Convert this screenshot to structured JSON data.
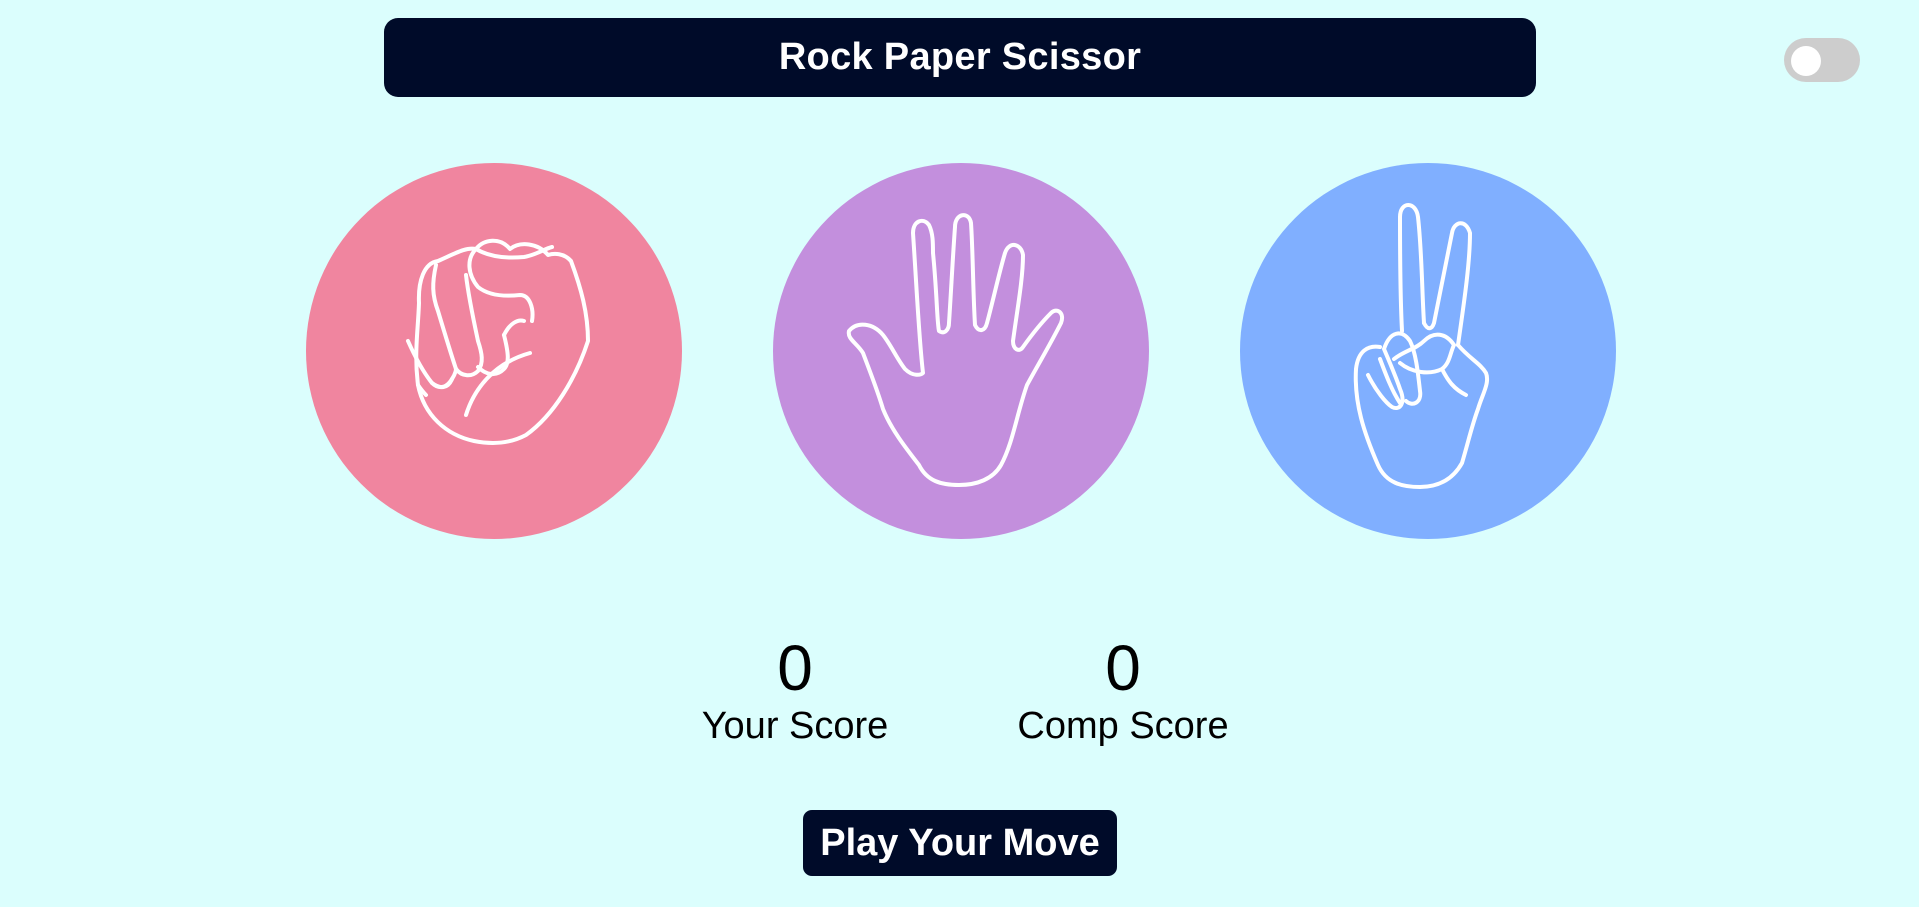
{
  "header": {
    "title": "Rock Paper Scissor"
  },
  "theme_toggle": {
    "state": "off"
  },
  "choices": [
    {
      "id": "rock",
      "icon": "fist-icon",
      "color": "#f0859f"
    },
    {
      "id": "paper",
      "icon": "open-hand-icon",
      "color": "#c38fdd"
    },
    {
      "id": "scissor",
      "icon": "peace-hand-icon",
      "color": "#80afff"
    }
  ],
  "scoreboard": {
    "user": {
      "value": "0",
      "label": "Your Score"
    },
    "comp": {
      "value": "0",
      "label": "Comp Score"
    }
  },
  "message": {
    "text": "Play Your Move"
  },
  "colors": {
    "background": "#dbfefd",
    "dark": "#000b29",
    "toggle_track": "#cdcdcd"
  }
}
